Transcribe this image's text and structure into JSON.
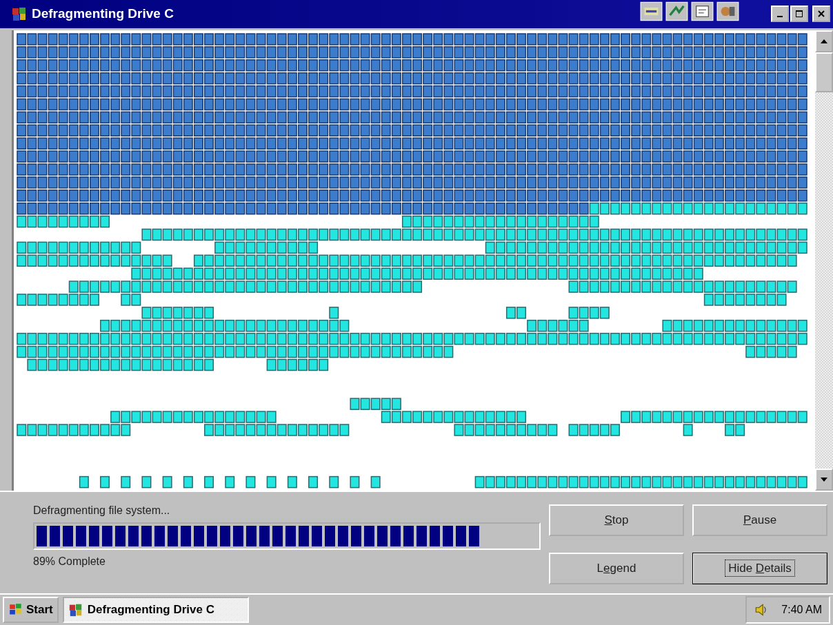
{
  "window": {
    "title": "Defragmenting Drive C"
  },
  "status": {
    "text": "Defragmenting file system...",
    "level": 0.89,
    "percent": "89% Complete"
  },
  "buttons": [
    {
      "key": "S",
      "after": "top",
      "focused": false
    },
    {
      "key": "P",
      "after": "ause",
      "focused": false
    },
    {
      "before": "L",
      "key": "e",
      "after": "gend",
      "focused": false
    },
    {
      "before": "Hide ",
      "key": "D",
      "after": "etails",
      "focused": true
    }
  ],
  "taskbar": {
    "start": "Start",
    "tasks": [
      {
        "label": "Defragmenting Drive C",
        "selected": true
      }
    ],
    "clock": "7:40 AM"
  }
}
